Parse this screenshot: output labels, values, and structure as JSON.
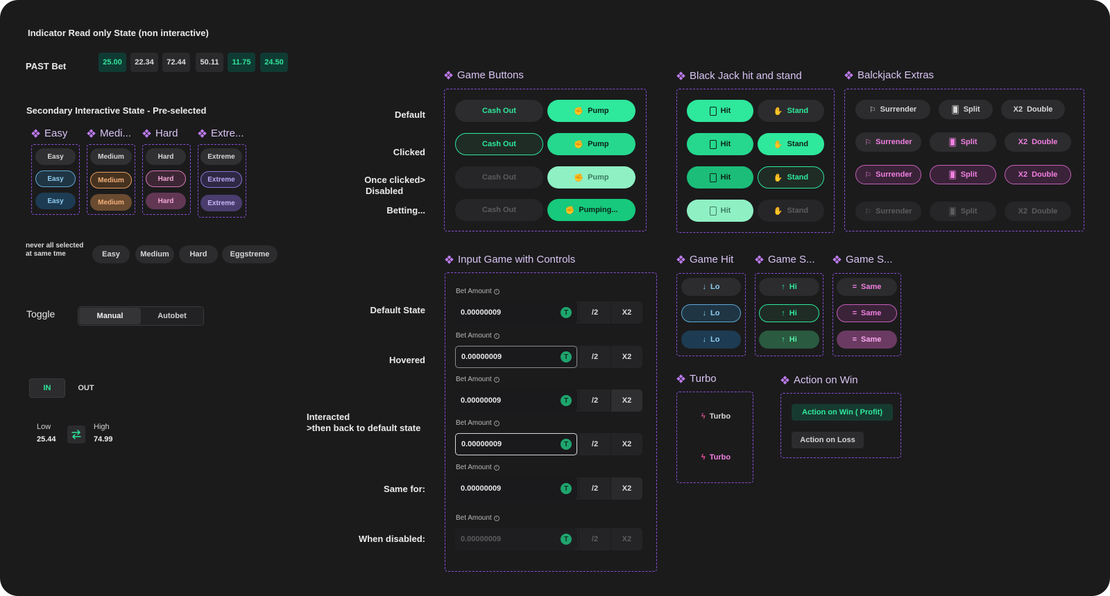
{
  "indicator": {
    "title": "Indicator Read only  State (non interactive)",
    "past_bet_label": "PAST Bet",
    "chips": [
      {
        "value": "25.00",
        "bg": "#0f3b33",
        "fg": "#33e29a"
      },
      {
        "value": "22.34",
        "bg": "#2a2a2d",
        "fg": "#dcdcdc"
      },
      {
        "value": "72.44",
        "bg": "#2a2a2d",
        "fg": "#dcdcdc"
      },
      {
        "value": "50.11",
        "bg": "#2a2a2d",
        "fg": "#dcdcdc"
      },
      {
        "value": "11.75",
        "bg": "#0f3b33",
        "fg": "#33e29a"
      },
      {
        "value": "24.50",
        "bg": "#0f3b33",
        "fg": "#33e29a"
      }
    ]
  },
  "secondary": {
    "title": "Secondary Interactive State - Pre-selected",
    "groups": [
      {
        "title": "Easy",
        "label": "Easy"
      },
      {
        "title": "Medi...",
        "label": "Medium"
      },
      {
        "title": "Hard",
        "label": "Hard"
      },
      {
        "title": "Extre...",
        "label": "Extreme"
      }
    ],
    "never_label_1": "never all selected",
    "never_label_2": "at same tme",
    "never_options": [
      "Easy",
      "Medium",
      "Hard",
      "Eggstreme"
    ]
  },
  "toggle": {
    "label": "Toggle",
    "manual": "Manual",
    "autobet": "Autobet"
  },
  "inout": {
    "in": "IN",
    "out": "OUT"
  },
  "lowhigh": {
    "low_label": "Low",
    "low_value": "25.44",
    "high_label": "High",
    "high_value": "74.99"
  },
  "game_buttons": {
    "title": "Game Buttons",
    "rows": [
      "Default",
      "Clicked",
      "Once clicked>",
      "Disabled",
      "Betting..."
    ],
    "cash_out": "Cash Out",
    "pump": "Pump",
    "pumping": "Pumping..."
  },
  "blackjack": {
    "title": "Black Jack hit and stand",
    "hit": "Hit",
    "stand": "Stand"
  },
  "extras": {
    "title": "Balckjack Extras",
    "surrender": "Surrender",
    "split": "Split",
    "double": "Double",
    "x2": "X2"
  },
  "input_game": {
    "title": "Input Game with Controls",
    "bet_label": "Bet Amount",
    "value": "0.00000009",
    "token": "T",
    "half": "/2",
    "double": "X2",
    "row_labels": [
      "Default State",
      "Hovered",
      "Interacted",
      ">then back to default state",
      "Same for:",
      "When disabled:"
    ]
  },
  "game_hit": {
    "title": "Game Hit",
    "label": "Lo"
  },
  "game_s1": {
    "title": "Game S...",
    "label": "Hi"
  },
  "game_s2": {
    "title": "Game S...",
    "label": "Same"
  },
  "turbo": {
    "title": "Turbo",
    "label": "Turbo"
  },
  "action_on_win": {
    "title": "Action on Win",
    "win": "Action on Win ( Profit)",
    "loss": "Action on Loss"
  },
  "colors": {
    "accent_green": "#2ee89c",
    "accent_purple": "#b45ae6",
    "dashed_border": "#8a4fd6",
    "bg": "#1b1b1c"
  }
}
